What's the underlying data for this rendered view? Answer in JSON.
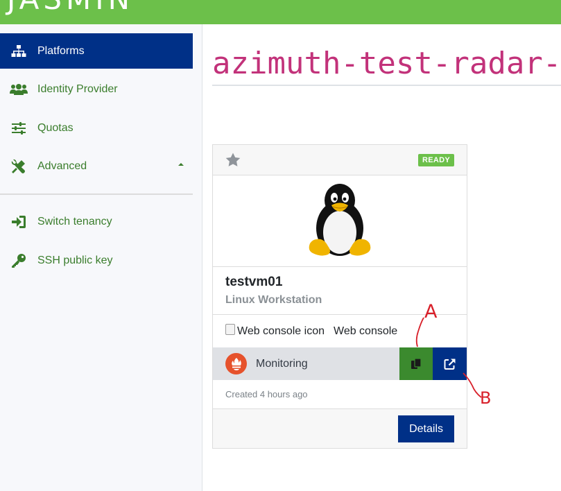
{
  "app": {
    "logo_text": "JASMIN"
  },
  "sidebar": {
    "items": [
      {
        "label": "Platforms",
        "icon": "sitemap-icon",
        "active": true
      },
      {
        "label": "Identity Provider",
        "icon": "users-icon"
      },
      {
        "label": "Quotas",
        "icon": "sliders-icon"
      },
      {
        "label": "Advanced",
        "icon": "tools-icon"
      },
      {
        "label": "Switch tenancy",
        "icon": "sign-in-icon"
      },
      {
        "label": "SSH public key",
        "icon": "key-icon"
      }
    ]
  },
  "main": {
    "title": "azimuth-test-radar-U"
  },
  "card": {
    "status": "READY",
    "name": "testvm01",
    "subtitle": "Linux Workstation",
    "web_console": {
      "alt": "Web console icon",
      "label": "Web console"
    },
    "monitoring": {
      "label": "Monitoring"
    },
    "created": "Created 4 hours ago",
    "details_label": "Details"
  },
  "annotations": {
    "a": "A",
    "b": "B"
  },
  "colors": {
    "brand_green": "#6cc04a",
    "nav_active": "#003087",
    "title_pink": "#c2327a",
    "copy_green": "#3b8a2e",
    "annotation_red": "#d8202a"
  }
}
